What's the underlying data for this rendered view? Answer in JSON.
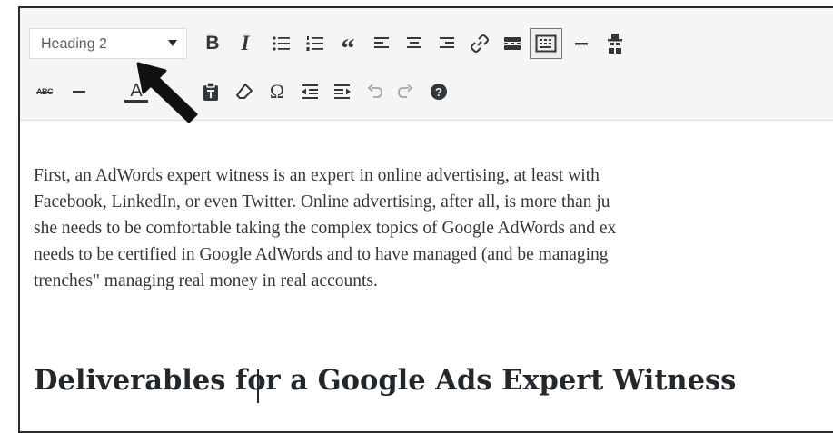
{
  "toolbar": {
    "format_select_value": "Heading 2",
    "row1_icons": [
      "bold-icon",
      "italic-icon",
      "bulleted-list-icon",
      "numbered-list-icon",
      "blockquote-icon",
      "align-left-icon",
      "align-center-icon",
      "align-right-icon",
      "insert-link-icon",
      "read-more-icon",
      "toolbar-toggle-icon",
      "horizontal-line-icon",
      "spy-icon"
    ],
    "row2_icons": [
      "strikethrough-icon",
      "horizontal-line-icon",
      "text-color-icon",
      "paste-as-text-icon",
      "clear-formatting-icon",
      "special-character-icon",
      "outdent-icon",
      "indent-icon",
      "undo-icon",
      "redo-icon",
      "help-icon"
    ],
    "bold_label": "B",
    "italic_label": "I",
    "quote_label": "“",
    "omega_label": "Ω",
    "text_color_label": "A",
    "strike_label": "ABC",
    "help_label": "?"
  },
  "content": {
    "paragraph_lines": [
      "First, an AdWords expert witness is an expert in online advertising, at least with",
      "Facebook, LinkedIn, or even Twitter. Online advertising, after all, is more than ju",
      "she needs to be comfortable taking the complex topics of Google AdWords and ex",
      "needs to be certified in Google AdWords and to have managed (and be managing",
      "trenches\" managing real money in real accounts."
    ],
    "heading": "Deliverables for a Google Ads Expert Witness"
  },
  "colors": {
    "toolbar_bg": "#f5f5f5",
    "icon": "#32373c",
    "text": "#32373c",
    "annotation_arrow": "#111111"
  }
}
